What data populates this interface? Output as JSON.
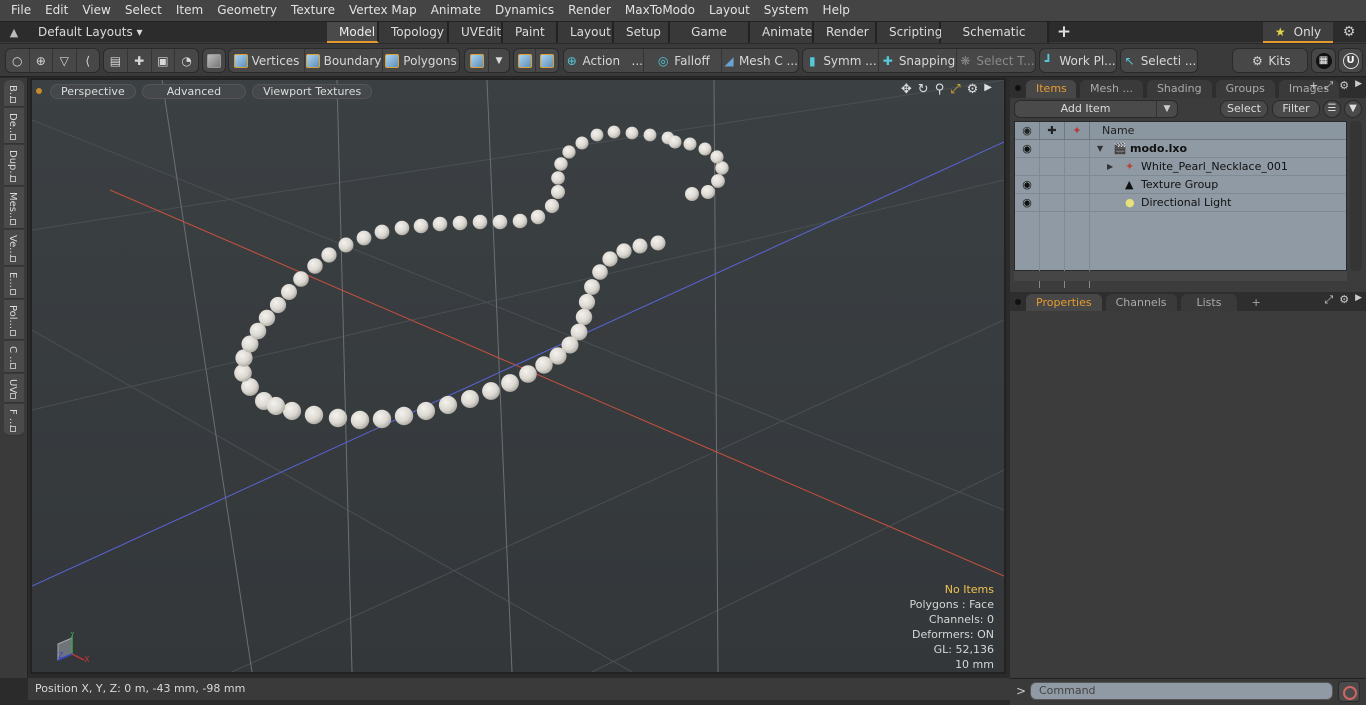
{
  "menu": [
    "File",
    "Edit",
    "View",
    "Select",
    "Item",
    "Geometry",
    "Texture",
    "Vertex Map",
    "Animate",
    "Dynamics",
    "Render",
    "MaxToModo",
    "Layout",
    "System",
    "Help"
  ],
  "layoutbar": {
    "layout_dropdown": "Default Layouts ▾",
    "tabs": [
      "Model",
      "Topology",
      "UVEdit",
      "Paint",
      "Layout",
      "Setup",
      "Game Tools",
      "Animate",
      "Render",
      "Scripting",
      "Schematic Fusion"
    ],
    "active_tab": "Model",
    "add_tab": "+",
    "only_label": "Only",
    "star": "★",
    "gear": "⚙"
  },
  "toolbar": {
    "vertices": "Vertices",
    "boundary": "Boundary",
    "polygons": "Polygons",
    "action": "Action   ...",
    "falloff": "Falloff",
    "mesh_constraints": "Mesh C ...",
    "symmetry": "Symm ...",
    "snapping": "Snapping",
    "select_through": "Select T...",
    "work_plane": "Work Pl...",
    "selection_sets": "Selecti ...",
    "kits": "Kits"
  },
  "left_tabs": [
    "B...",
    "De...",
    "Dup...",
    "Mes...",
    "Ve...",
    "E...",
    "Pol...",
    "C ...",
    "UV",
    "F ..."
  ],
  "viewport": {
    "perspective": "Perspective",
    "advanced": "Advanced",
    "viewport_textures": "Viewport Textures",
    "info": {
      "selection": "No Items",
      "polygons": "Polygons : Face",
      "channels": "Channels: 0",
      "deformers": "Deformers: ON",
      "gl": "GL: 52,136",
      "scale": "10 mm"
    },
    "axis_labels": {
      "x": "X",
      "y": "Y",
      "z": "Z"
    }
  },
  "status": {
    "position": "Position X, Y, Z:   0 m, -43 mm, -98 mm"
  },
  "panel_top": {
    "tabs": [
      "Items",
      "Mesh ...",
      "Shading",
      "Groups",
      "Images"
    ],
    "active_tab": "Items",
    "add_item": "Add Item",
    "select": "Select",
    "filter": "Filter",
    "column_name": "Name",
    "items": [
      {
        "name": "modo.lxo",
        "visible": true,
        "level": 0,
        "expanded": true,
        "icon": "scene-icon"
      },
      {
        "name": "White_Pearl_Necklace_001",
        "visible": false,
        "level": 1,
        "expanded": false,
        "icon": "mesh-locator-icon"
      },
      {
        "name": "Texture Group",
        "visible": true,
        "level": 1,
        "icon": "texture-group-icon"
      },
      {
        "name": "Directional Light",
        "visible": true,
        "level": 1,
        "icon": "light-icon"
      }
    ]
  },
  "panel_bottom": {
    "tabs": [
      "Properties",
      "Channels",
      "Lists"
    ],
    "active_tab": "Properties",
    "add_tab": "+"
  },
  "command": {
    "prompt": ">",
    "placeholder": "Command"
  },
  "colors": {
    "accent": "#e39a2f",
    "x_axis": "#d0503c",
    "z_axis": "#5560d8",
    "info_warning": "#f0c252"
  }
}
